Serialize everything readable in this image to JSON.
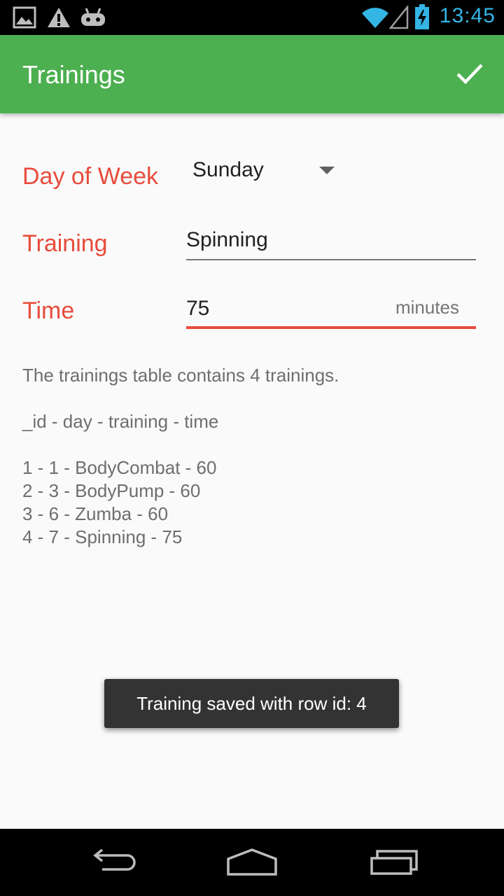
{
  "status_bar": {
    "time": "13:45",
    "icons": [
      "image-icon",
      "warning-icon",
      "android-icon",
      "wifi-icon",
      "signal-icon",
      "battery-charging-icon"
    ]
  },
  "app_bar": {
    "title": "Trainings",
    "action_icon": "checkmark-icon"
  },
  "form": {
    "day_label": "Day of Week",
    "day_value": "Sunday",
    "training_label": "Training",
    "training_value": "Spinning",
    "time_label": "Time",
    "time_value": "75",
    "time_suffix": "minutes"
  },
  "info": {
    "summary": "The trainings table contains 4 trainings.",
    "header": "_id - day - training - time",
    "rows": [
      "1 - 1 - BodyCombat - 60",
      "2 - 3 - BodyPump - 60",
      "3 - 6 - Zumba - 60",
      "4 - 7 - Spinning - 75"
    ]
  },
  "toast": {
    "message": "Training saved with row id: 4"
  },
  "nav_bar": {
    "icons": [
      "back-icon",
      "home-icon",
      "recents-icon"
    ]
  },
  "colors": {
    "app_bar": "#4caf50",
    "accent": "#e74c3c",
    "status_text": "#33b5e5"
  }
}
